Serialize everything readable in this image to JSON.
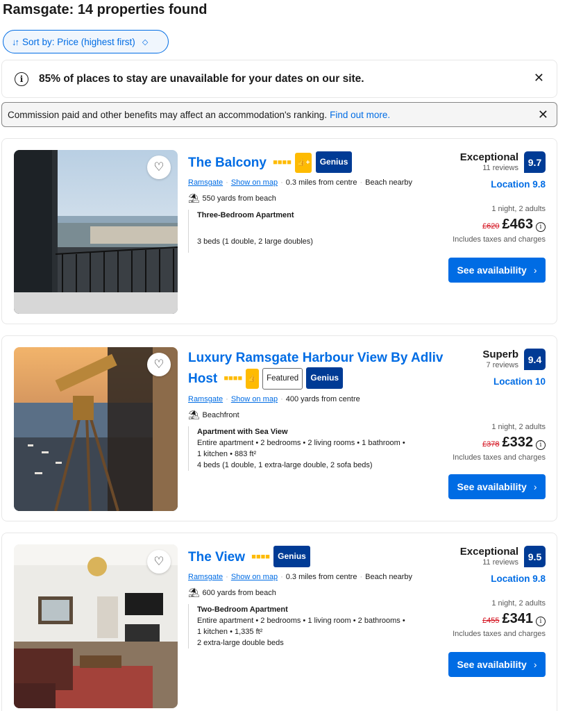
{
  "header": {
    "title": "Ramsgate: 14 properties found"
  },
  "sort": {
    "label": "Sort by: Price (highest first)",
    "icon": "sort-arrows-icon"
  },
  "availability_banner": {
    "text": "85% of places to stay are unavailable for your dates on our site.",
    "close": "✕"
  },
  "commission": {
    "text": "Commission paid and other benefits may affect an accommodation's ranking.",
    "link": "Find out more.",
    "close": "✕"
  },
  "listings": [
    {
      "name": "The Balcony",
      "stars": "■■■■",
      "thumb_badge": "👍+",
      "featured": "",
      "genius": "Genius",
      "city": "Ramsgate",
      "map_link": "Show on map",
      "distance": "0.3 miles from centre",
      "extra": "Beach nearby",
      "feature": "550 yards from beach",
      "unit_title": "Three-Bedroom Apartment",
      "unit_line1": "",
      "unit_line2": "",
      "beds": "3 beds (1 double, 2 large doubles)",
      "review_word": "Exceptional",
      "review_count": "11 reviews",
      "score": "9.7",
      "location": "Location 9.8",
      "nights": "1 night, 2 adults",
      "old_price": "£620",
      "price": "£463",
      "taxes": "Includes taxes and charges",
      "button": "See availability"
    },
    {
      "name": "Luxury Ramsgate Harbour View By Adliv Host",
      "stars": "■■■■",
      "thumb_badge": "👍",
      "featured": "Featured",
      "genius": "Genius",
      "city": "Ramsgate",
      "map_link": "Show on map",
      "distance": "400 yards from centre",
      "extra": "",
      "feature": "Beachfront",
      "unit_title": "Apartment with Sea View",
      "unit_line1": "Entire apartment • 2 bedrooms • 2 living rooms • 1 bathroom •",
      "unit_line2": "1 kitchen • 883 ft²",
      "beds": "4 beds (1 double, 1 extra-large double, 2 sofa beds)",
      "review_word": "Superb",
      "review_count": "7 reviews",
      "score": "9.4",
      "location": "Location 10",
      "nights": "1 night, 2 adults",
      "old_price": "£378",
      "price": "£332",
      "taxes": "Includes taxes and charges",
      "button": "See availability"
    },
    {
      "name": "The View",
      "stars": "■■■■",
      "thumb_badge": "",
      "featured": "",
      "genius": "Genius",
      "city": "Ramsgate",
      "map_link": "Show on map",
      "distance": "0.3 miles from centre",
      "extra": "Beach nearby",
      "feature": "600 yards from beach",
      "unit_title": "Two-Bedroom Apartment",
      "unit_line1": "Entire apartment • 2 bedrooms • 1 living room • 2 bathrooms •",
      "unit_line2": "1 kitchen • 1,335 ft²",
      "beds": "2 extra-large double beds",
      "review_word": "Exceptional",
      "review_count": "11 reviews",
      "score": "9.5",
      "location": "Location 9.8",
      "nights": "1 night, 2 adults",
      "old_price": "£455",
      "price": "£341",
      "taxes": "Includes taxes and charges",
      "button": "See availability"
    }
  ]
}
